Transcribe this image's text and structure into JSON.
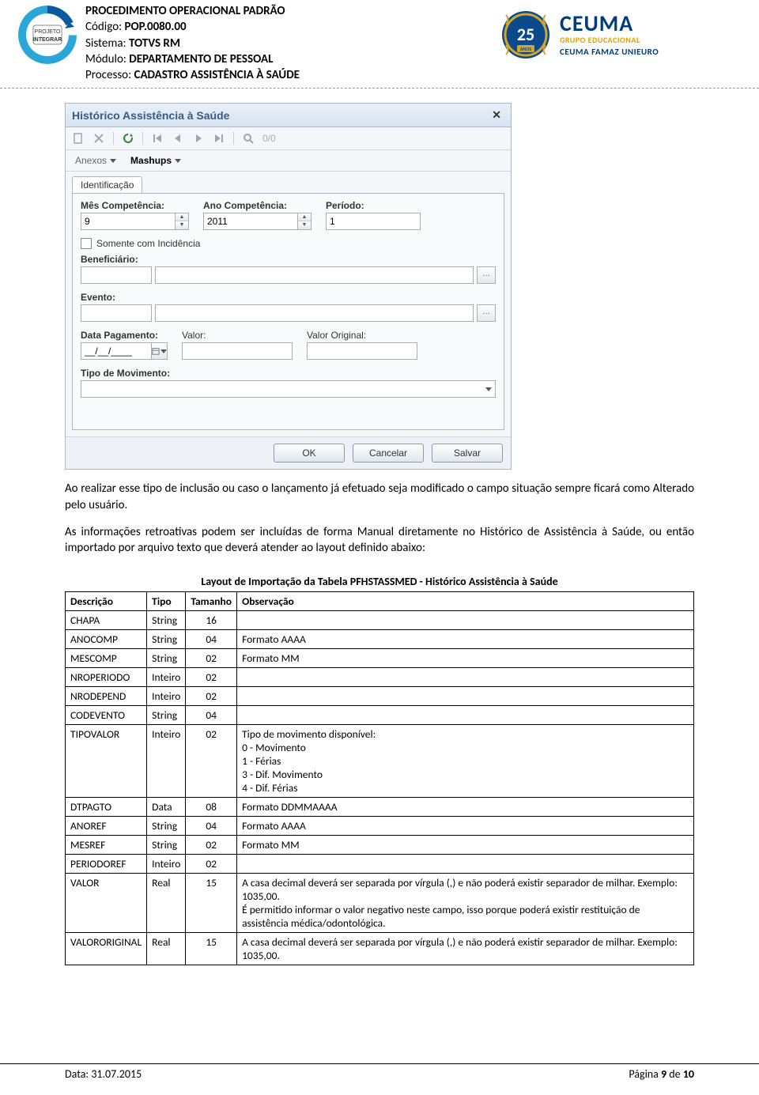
{
  "header": {
    "title": "PROCEDIMENTO OPERACIONAL PADRÃO",
    "codigo_label": "Código: ",
    "codigo": "POP.0080.00",
    "sistema_label": "Sistema: ",
    "sistema": "TOTVS RM",
    "modulo_label": "Módulo: ",
    "modulo": "DEPARTAMENTO DE PESSOAL",
    "processo_label": "Processo: ",
    "processo": "CADASTRO ASSISTÊNCIA À SAÚDE",
    "logo_left_top": "PROJETO",
    "logo_left_bottom": "INTEGRAR",
    "badge_num": "25",
    "badge_sub": "ANOS",
    "ceuma": "CEUMA",
    "ceuma_sub": "GRUPO EDUCACIONAL",
    "ceuma_row2": "CEUMA  FAMAZ  UNIEURO"
  },
  "dialog": {
    "title": "Histórico Assistência à Saúde",
    "counter": "0/0",
    "anexos": "Anexos",
    "mashups": "Mashups",
    "tab": "Identificação",
    "mes_label": "Mês Competência:",
    "mes_value": "9",
    "ano_label": "Ano Competência:",
    "ano_value": "2011",
    "periodo_label": "Período:",
    "periodo_value": "1",
    "somente_label": "Somente com Incidência",
    "beneficiario_label": "Beneficiário:",
    "evento_label": "Evento:",
    "data_pag_label": "Data Pagamento:",
    "data_pag_value": "__/__/____",
    "valor_label": "Valor:",
    "valor_orig_label": "Valor Original:",
    "tipo_mov_label": "Tipo de Movimento:",
    "btn_ok": "OK",
    "btn_cancel": "Cancelar",
    "btn_save": "Salvar"
  },
  "body": {
    "p1": "Ao realizar esse tipo de inclusão ou caso o lançamento já efetuado seja modificado o campo situação sempre ficará como Alterado pelo usuário.",
    "p2": "As informações retroativas podem ser incluídas de forma Manual diretamente no Histórico de Assistência à Saúde, ou então importado por arquivo texto que deverá atender ao layout definido abaixo:"
  },
  "layout_table": {
    "caption": "Layout de Importação da Tabela PFHSTASSMED - Histórico Assistência à Saúde",
    "headers": [
      "Descrição",
      "Tipo",
      "Tamanho",
      "Observação"
    ],
    "rows": [
      {
        "desc": "CHAPA",
        "tipo": "String",
        "tam": "16",
        "obs": ""
      },
      {
        "desc": "ANOCOMP",
        "tipo": "String",
        "tam": "04",
        "obs": "Formato AAAA"
      },
      {
        "desc": "MESCOMP",
        "tipo": "String",
        "tam": "02",
        "obs": "Formato MM"
      },
      {
        "desc": "NROPERIODO",
        "tipo": "Inteiro",
        "tam": "02",
        "obs": ""
      },
      {
        "desc": "NRODEPEND",
        "tipo": "Inteiro",
        "tam": "02",
        "obs": ""
      },
      {
        "desc": "CODEVENTO",
        "tipo": "String",
        "tam": "04",
        "obs": ""
      },
      {
        "desc": "TIPOVALOR",
        "tipo": "Inteiro",
        "tam": "02",
        "obs": "Tipo de movimento disponível:\n    0 - Movimento\n    1 - Férias\n    3 - Dif. Movimento\n    4 - Dif. Férias"
      },
      {
        "desc": "DTPAGTO",
        "tipo": "Data",
        "tam": "08",
        "obs": "Formato DDMMAAAA"
      },
      {
        "desc": "ANOREF",
        "tipo": "String",
        "tam": "04",
        "obs": "Formato AAAA"
      },
      {
        "desc": "MESREF",
        "tipo": "String",
        "tam": "02",
        "obs": "Formato MM"
      },
      {
        "desc": "PERIODOREF",
        "tipo": "Inteiro",
        "tam": "02",
        "obs": ""
      },
      {
        "desc": "VALOR",
        "tipo": "Real",
        "tam": "15",
        "obs": "A casa decimal deverá ser separada por vírgula (,) e não poderá existir separador de milhar. Exemplo: 1035,00.\nÉ permitido informar o valor negativo neste campo, isso porque poderá existir restituição de assistência médica/odontológica."
      },
      {
        "desc": "VALORORIGINAL",
        "tipo": "Real",
        "tam": "15",
        "obs": "A casa decimal deverá ser separada por vírgula (,) e não poderá existir separador de milhar. Exemplo: 1035,00."
      }
    ]
  },
  "footer": {
    "left": "Data: 31.07.2015",
    "right_prefix": "Página ",
    "page_cur": "9",
    "sep": " de ",
    "page_tot": "10"
  }
}
